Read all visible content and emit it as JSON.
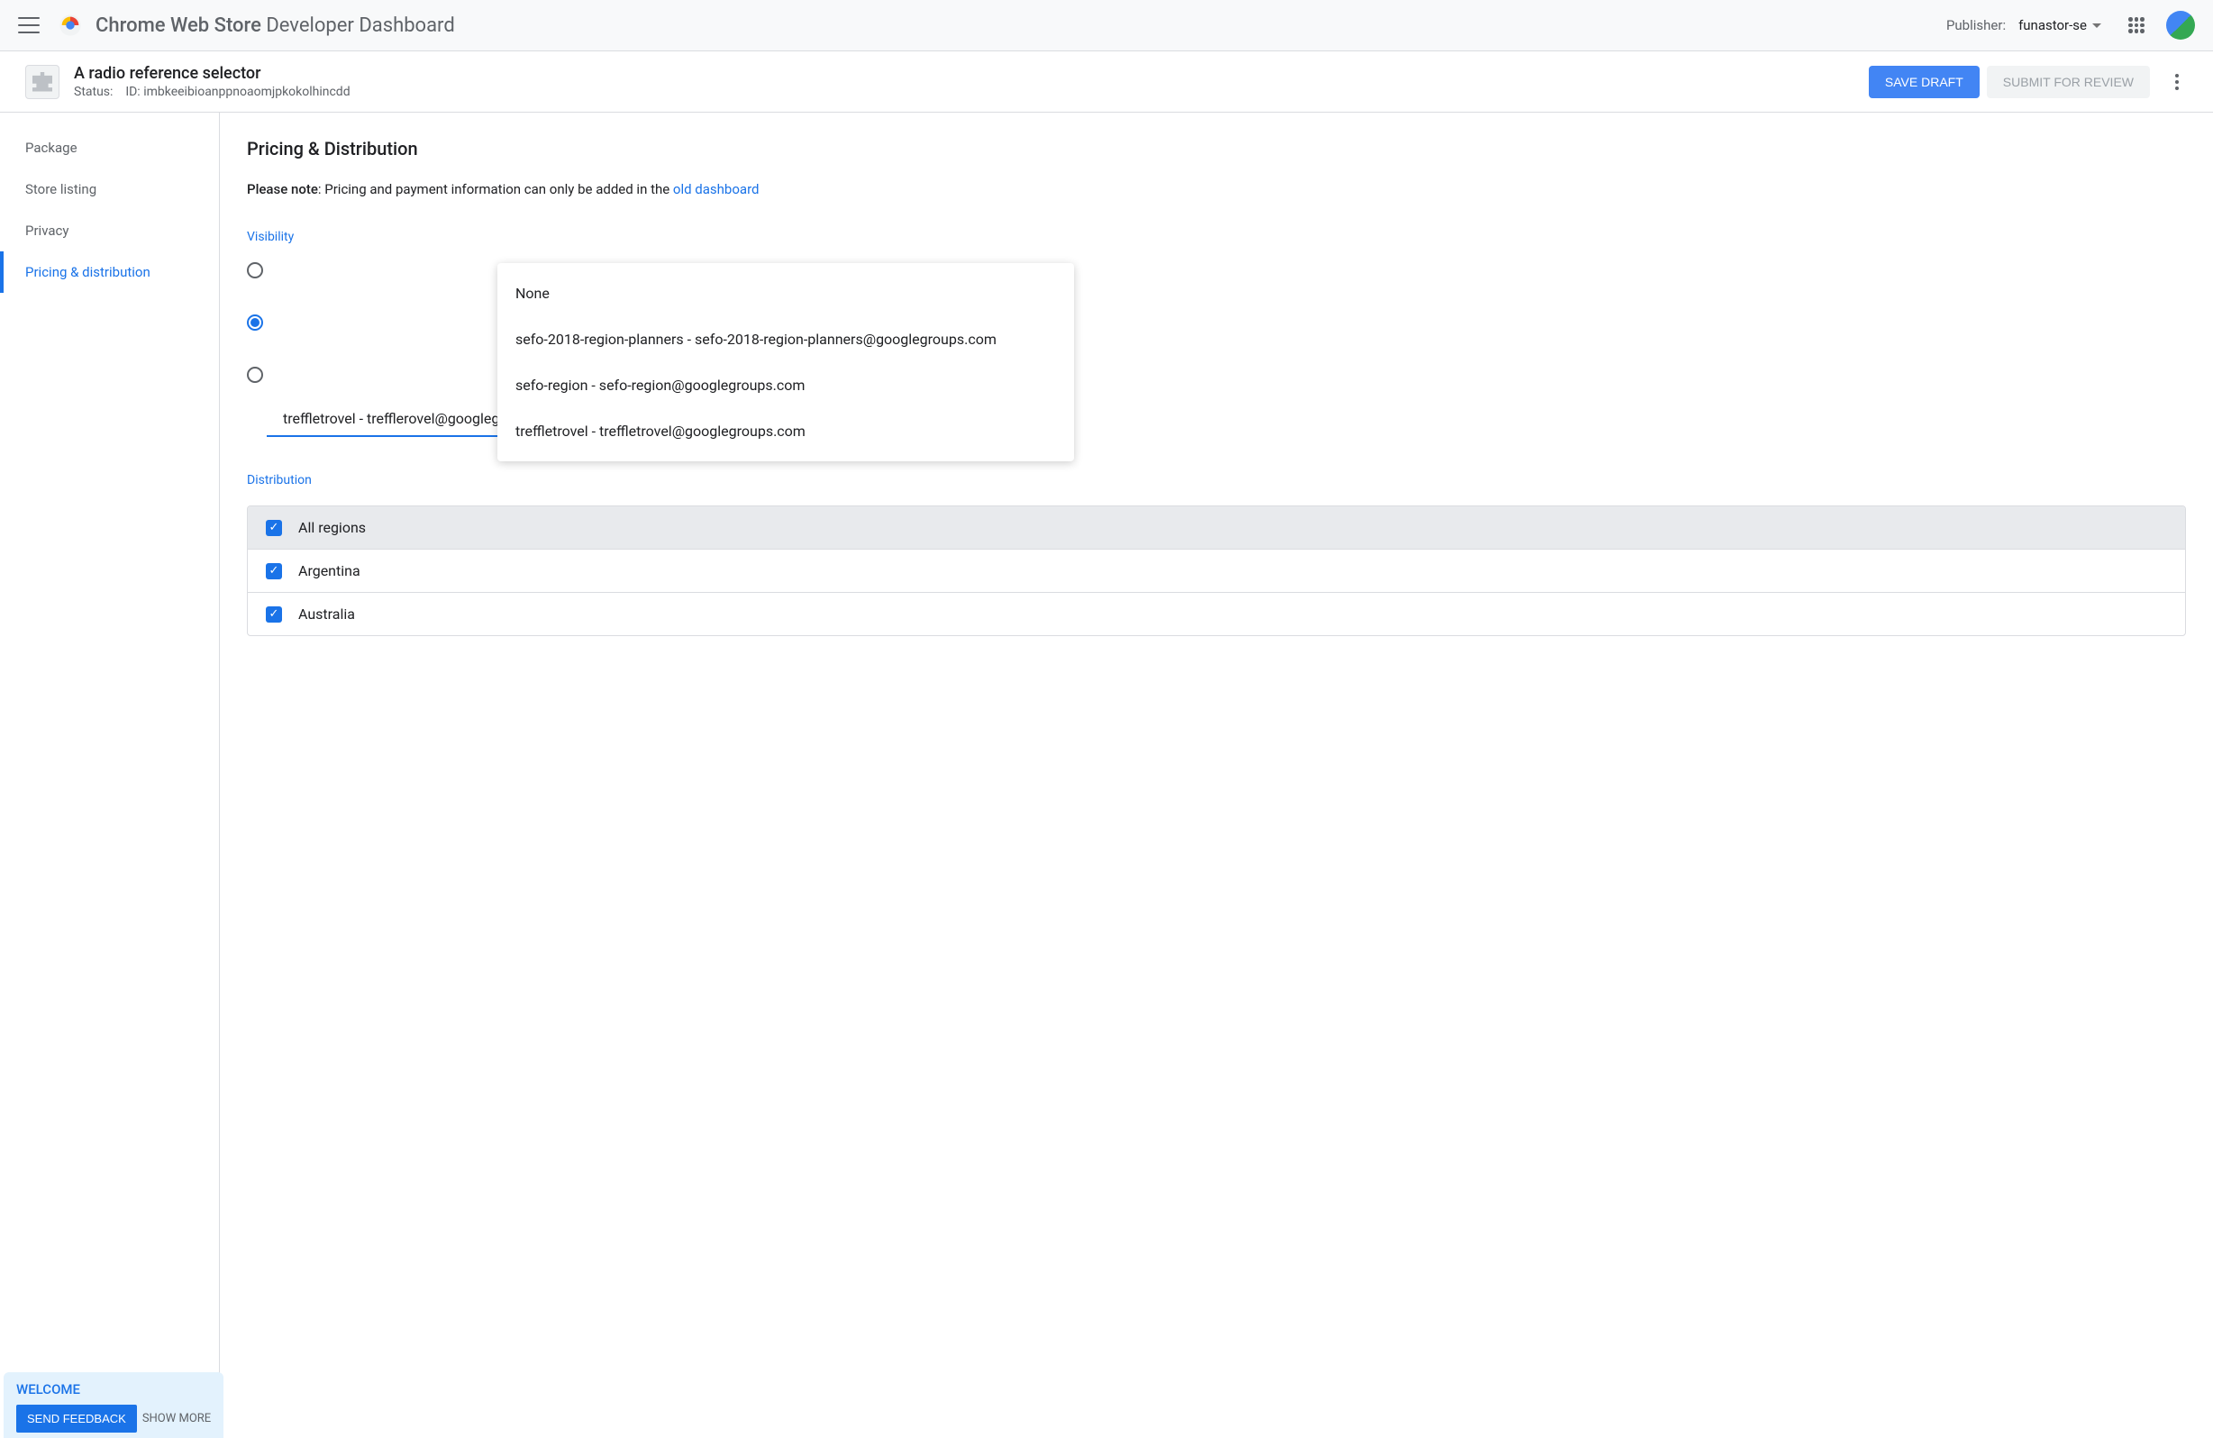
{
  "header": {
    "title_bold": "Chrome Web Store",
    "title_light": "Developer Dashboard",
    "publisher_label": "Publisher:",
    "publisher_value": "funastor-se"
  },
  "extension": {
    "name": "A radio reference selector",
    "status_label": "Status:",
    "id_label": "ID:",
    "id_value": "imbkeeibioanppnoaomjpkokolhincdd"
  },
  "buttons": {
    "save_draft": "SAVE DRAFT",
    "submit_review": "SUBMIT FOR REVIEW"
  },
  "sidebar": {
    "items": [
      {
        "label": "Package",
        "active": false
      },
      {
        "label": "Store listing",
        "active": false
      },
      {
        "label": "Privacy",
        "active": false
      },
      {
        "label": "Pricing & distribution",
        "active": true
      }
    ]
  },
  "main": {
    "title": "Pricing & Distribution",
    "note_bold": "Please note",
    "note_text": ": Pricing and payment information can only be added in the ",
    "note_link": "old dashboard",
    "visibility_label": "Visibility",
    "dropdown_value": "treffletrovel - trefflerovel@googlegroups.com",
    "dropdown_options": [
      "None",
      "sefo-2018-region-planners - sefo-2018-region-planners@googlegroups.com",
      "sefo-region - sefo-region@googlegroups.com",
      "treffletrovel - treffletrovel@googlegroups.com"
    ],
    "distribution_label": "Distribution",
    "regions": [
      {
        "label": "All regions",
        "checked": true,
        "header": true
      },
      {
        "label": "Argentina",
        "checked": true,
        "header": false
      },
      {
        "label": "Australia",
        "checked": true,
        "header": false
      }
    ]
  },
  "feedback": {
    "title": "WELCOME",
    "button": "SEND FEEDBACK",
    "more": "SHOW MORE"
  }
}
